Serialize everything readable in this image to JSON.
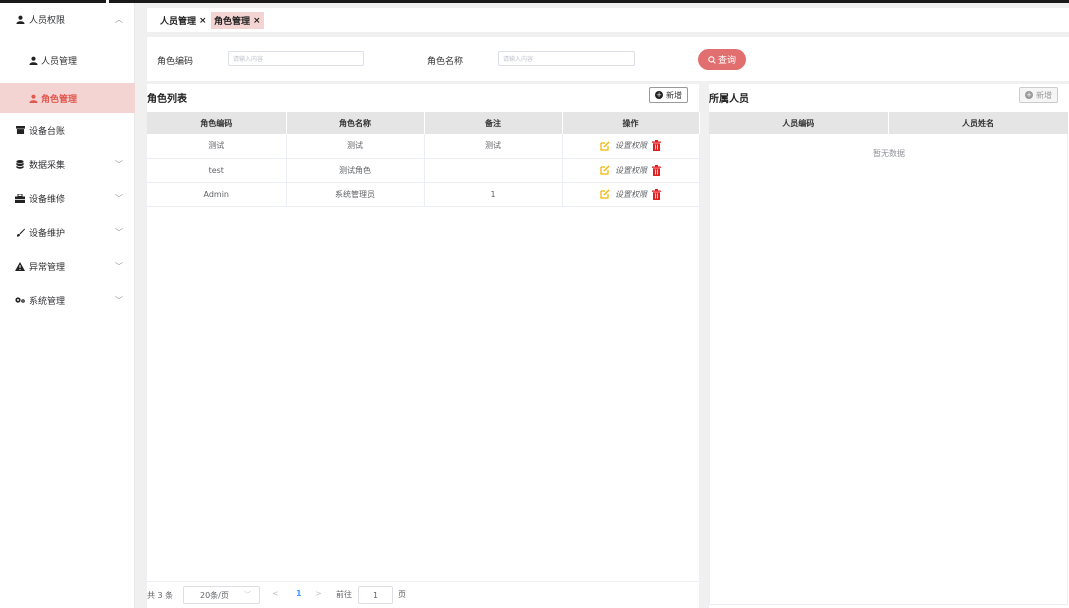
{
  "sidebar": {
    "items": [
      {
        "label": "人员权限",
        "icon": "user-icon",
        "chevron": "up"
      },
      {
        "label": "人员管理",
        "icon": "user-icon",
        "sub": true
      },
      {
        "label": "角色管理",
        "icon": "user-icon",
        "sub": true,
        "active": true
      },
      {
        "label": "设备台账",
        "icon": "device-icon"
      },
      {
        "label": "数据采集",
        "icon": "database-icon",
        "chevron": "down"
      },
      {
        "label": "设备维修",
        "icon": "toolbox-icon",
        "chevron": "down"
      },
      {
        "label": "设备维护",
        "icon": "brush-icon",
        "chevron": "down"
      },
      {
        "label": "异常管理",
        "icon": "warning-icon",
        "chevron": "down"
      },
      {
        "label": "系统管理",
        "icon": "gears-icon",
        "chevron": "down"
      }
    ]
  },
  "tabs": [
    {
      "label": "人员管理",
      "close": "×"
    },
    {
      "label": "角色管理",
      "close": "×",
      "active": true
    }
  ],
  "search": {
    "role_code_label": "角色编码",
    "role_code_placeholder": "请输入内容",
    "role_name_label": "角色名称",
    "role_name_placeholder": "请输入内容",
    "query_label": "查询"
  },
  "role_list": {
    "title": "角色列表",
    "add_label": "新增",
    "columns": [
      "角色编码",
      "角色名称",
      "备注",
      "操作"
    ],
    "rows": [
      {
        "code": "测试",
        "name": "测试",
        "remark": "测试",
        "perm": "设置权限"
      },
      {
        "code": "test",
        "name": "测试角色",
        "remark": "",
        "perm": "设置权限"
      },
      {
        "code": "Admin",
        "name": "系统管理员",
        "remark": "1",
        "perm": "设置权限"
      }
    ]
  },
  "pagination": {
    "total": "共 3 条",
    "page_size": "20条/页",
    "current_page": "1",
    "goto_label": "前往",
    "goto_value": "1",
    "page_suffix": "页"
  },
  "members": {
    "title": "所属人员",
    "add_label": "新增",
    "columns": [
      "人员编码",
      "人员姓名"
    ],
    "empty_text": "暂无数据"
  },
  "colors": {
    "accent": "#e26f6f",
    "active_bg": "#f4d3d3",
    "edit_icon": "#f0b400",
    "delete_icon": "#e02020",
    "page_active": "#409eff"
  }
}
